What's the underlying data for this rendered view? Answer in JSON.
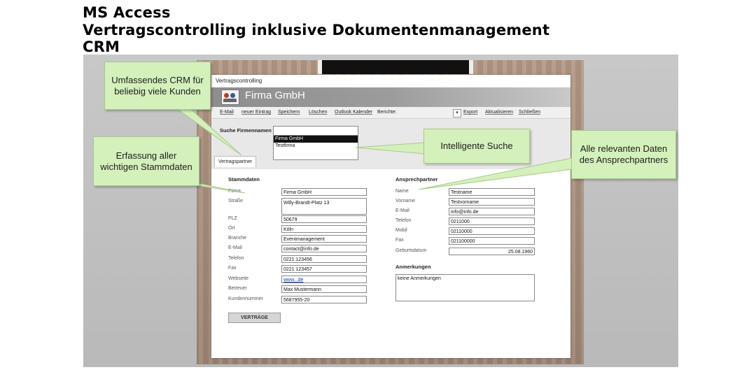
{
  "heading": {
    "line1": "MS Access",
    "line2": "Vertragscontrolling inklusive Dokumentenmanagement",
    "line3": "CRM"
  },
  "window": {
    "title": "Vertragscontrolling",
    "company": "Firma GmbH",
    "logo_icon": "contacts-icon"
  },
  "menu": [
    {
      "label": "E-Mail"
    },
    {
      "label": "neuer Eintrag"
    },
    {
      "label": "Speichern"
    },
    {
      "label": "Löschen"
    },
    {
      "label": "Outlook Kalender"
    },
    {
      "label": "Berichte:"
    },
    {
      "label": "Export"
    },
    {
      "label": "Aktualisieren"
    },
    {
      "label": "Schließen"
    }
  ],
  "search": {
    "label": "Suche Firmennamen",
    "value": "",
    "results": [
      "Firma GmbH",
      "Testfirma"
    ],
    "selected_index": 0
  },
  "tab": {
    "label": "Vertragspartner"
  },
  "stammdaten": {
    "title": "Stammdaten",
    "fields": [
      {
        "label": "Firma",
        "value": "Firma GmbH"
      },
      {
        "label": "Straße",
        "value": "Willy-Brandt-Platz 13"
      },
      {
        "label": "PLZ",
        "value": "50679"
      },
      {
        "label": "Ort",
        "value": "Köln"
      },
      {
        "label": "Branche",
        "value": "Eventmanagement"
      },
      {
        "label": "E-Mail",
        "value": "contact@info.de"
      },
      {
        "label": "Telefon",
        "value": "0221 123456"
      },
      {
        "label": "Fax",
        "value": "0221 123457"
      },
      {
        "label": "Webseite",
        "value": "www...de"
      },
      {
        "label": "Betreuer",
        "value": "Max Mustermann"
      },
      {
        "label": "Kundennummer",
        "value": "5687955-20"
      }
    ],
    "button": "VERTRÄGE"
  },
  "ansprechpartner": {
    "title": "Ansprechpartner",
    "fields": [
      {
        "label": "Name",
        "value": "Testname"
      },
      {
        "label": "Vorname",
        "value": "Testvorname"
      },
      {
        "label": "E-Mail",
        "value": "info@info.de"
      },
      {
        "label": "Telefon",
        "value": "0211000"
      },
      {
        "label": "Mobil",
        "value": "02110000"
      },
      {
        "label": "Fax",
        "value": "021100000"
      },
      {
        "label": "Geburtsdatum",
        "value": "25.08.1960"
      }
    ],
    "notes_title": "Anmerkungen",
    "notes_value": "keine Anmerkungen"
  },
  "callouts": {
    "crm": [
      "Umfassendes CRM für",
      "beliebig viele Kunden"
    ],
    "stammdaten": [
      "Erfassung aller",
      "wichtigen Stammdaten"
    ],
    "suche": [
      "Intelligente Suche"
    ],
    "ansprechpartner": [
      "Alle relevanten Daten",
      "des Ansprechpartners"
    ]
  },
  "colors": {
    "callout_bg": "#d4f0bb",
    "banner": "#9c9c9c",
    "selected_row": "#111111",
    "link": "#1a3ea8"
  }
}
